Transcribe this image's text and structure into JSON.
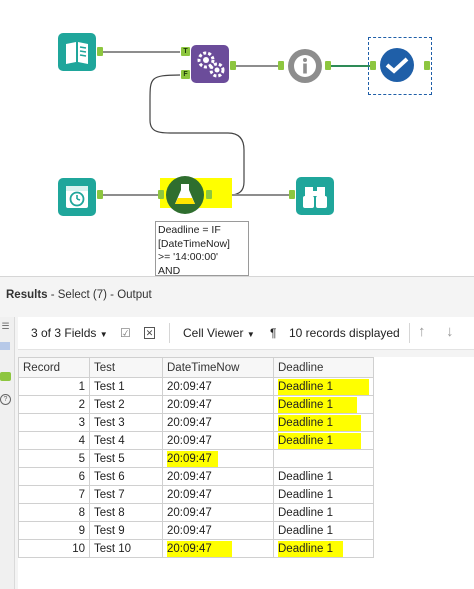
{
  "canvas": {
    "annotation_lines": [
      "Deadline = IF",
      "[DateTimeNow]",
      ">= '14:00:00'",
      "AND"
    ],
    "anchor_true_label": "T",
    "anchor_false_label": "F",
    "colors": {
      "teal": "#1fa69b",
      "purple": "#6b4c9a",
      "grey": "#8d8d8d",
      "blue": "#1f5fa8",
      "anchor": "#8dc63f",
      "highlight": "#ffff00"
    }
  },
  "results": {
    "title_bold": "Results",
    "title_rest": " - Select (7) - Output",
    "toolbar": {
      "fields": "3 of 3 Fields",
      "viewer": "Cell Viewer",
      "pilcrow": "¶",
      "records": "10 records displayed"
    },
    "table": {
      "headers": [
        "Record",
        "Test",
        "DateTimeNow",
        "Deadline"
      ],
      "rows": [
        [
          "1",
          "Test 1",
          "20:09:47",
          "Deadline 1"
        ],
        [
          "2",
          "Test 2",
          "20:09:47",
          "Deadline 1"
        ],
        [
          "3",
          "Test 3",
          "20:09:47",
          "Deadline 1"
        ],
        [
          "4",
          "Test 4",
          "20:09:47",
          "Deadline 1"
        ],
        [
          "5",
          "Test 5",
          "20:09:47",
          ""
        ],
        [
          "6",
          "Test 6",
          "20:09:47",
          "Deadline 1"
        ],
        [
          "7",
          "Test 7",
          "20:09:47",
          "Deadline 1"
        ],
        [
          "8",
          "Test 8",
          "20:09:47",
          "Deadline 1"
        ],
        [
          "9",
          "Test 9",
          "20:09:47",
          "Deadline 1"
        ],
        [
          "10",
          "Test 10",
          "20:09:47",
          "Deadline 1"
        ]
      ]
    }
  }
}
